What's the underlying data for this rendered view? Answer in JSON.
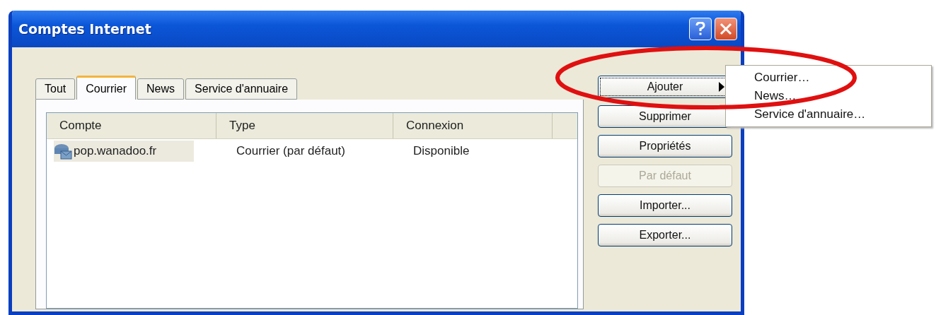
{
  "window": {
    "title": "Comptes Internet"
  },
  "tabs": [
    {
      "label": "Tout",
      "selected": false
    },
    {
      "label": "Courrier",
      "selected": true
    },
    {
      "label": "News",
      "selected": false
    },
    {
      "label": "Service d'annuaire",
      "selected": false
    }
  ],
  "table": {
    "columns": [
      "Compte",
      "Type",
      "Connexion"
    ],
    "rows": [
      {
        "cells": [
          "pop.wanadoo.fr",
          "Courrier (par défaut)",
          "Disponible"
        ],
        "selected": true
      }
    ]
  },
  "buttons": [
    {
      "label": "Ajouter",
      "kind": "submenu",
      "focused": true,
      "disabled": false
    },
    {
      "label": "Supprimer",
      "kind": "plain",
      "focused": false,
      "disabled": false
    },
    {
      "label": "Propriétés",
      "kind": "plain",
      "focused": false,
      "disabled": false
    },
    {
      "label": "Par défaut",
      "kind": "plain",
      "focused": false,
      "disabled": true
    },
    {
      "label": "Importer...",
      "kind": "plain",
      "focused": false,
      "disabled": false
    },
    {
      "label": "Exporter...",
      "kind": "plain",
      "focused": false,
      "disabled": false
    }
  ],
  "submenu": [
    "Courrier…",
    "News…",
    "Service d'annuaire…"
  ]
}
